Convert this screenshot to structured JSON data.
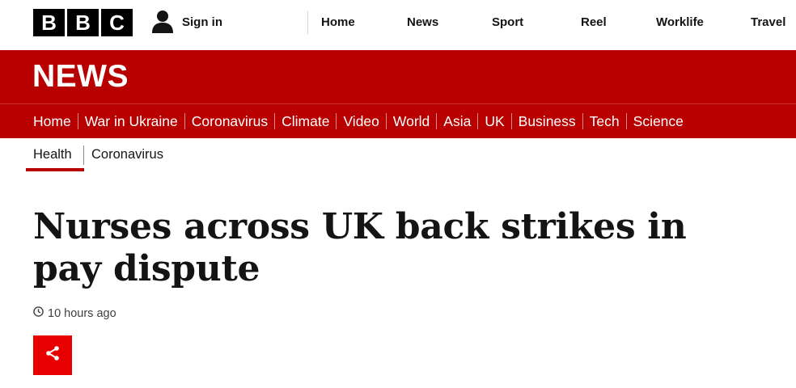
{
  "masthead": {
    "logo_letters": [
      "B",
      "B",
      "C"
    ],
    "signin_label": "Sign in",
    "nav": [
      "Home",
      "News",
      "Sport",
      "Reel",
      "Worklife",
      "Travel"
    ]
  },
  "news_band": {
    "title": "NEWS"
  },
  "section_nav": [
    "Home",
    "War in Ukraine",
    "Coronavirus",
    "Climate",
    "Video",
    "World",
    "Asia",
    "UK",
    "Business",
    "Tech",
    "Science"
  ],
  "sub_nav": {
    "active": "Health",
    "items": [
      "Health",
      "Coronavirus"
    ]
  },
  "article": {
    "headline": "Nurses across UK back strikes in pay dispute",
    "timestamp": "10 hours ago"
  },
  "colors": {
    "brand_red": "#b80000",
    "share_red": "#e80000",
    "text": "#141414"
  },
  "icons": {
    "signin": "person-icon",
    "time": "clock-icon",
    "share": "share-icon"
  }
}
